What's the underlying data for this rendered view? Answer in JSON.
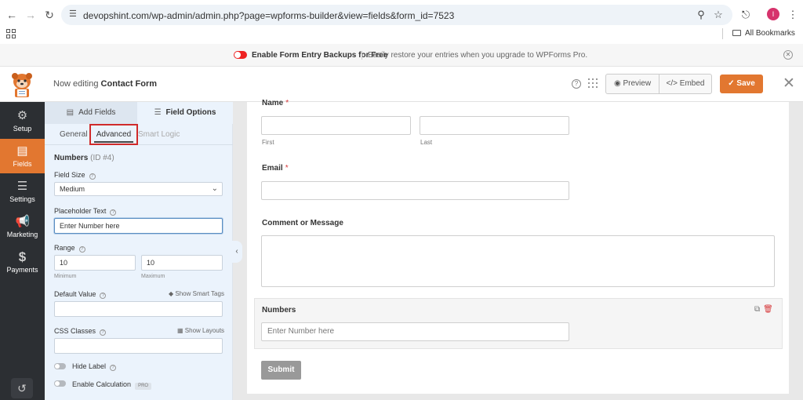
{
  "browser": {
    "url": "devopshint.com/wp-admin/admin.php?page=wpforms-builder&view=fields&form_id=7523",
    "bookmarks_label": "All Bookmarks",
    "profile_initial": "I"
  },
  "notice": {
    "title": "Enable Form Entry Backups for Free",
    "text": "Easily restore your entries when you upgrade to WPForms Pro."
  },
  "header": {
    "editing_prefix": "Now editing",
    "form_name": "Contact Form",
    "preview_label": "Preview",
    "embed_label": "Embed",
    "save_label": "Save"
  },
  "sidebar": {
    "items": [
      {
        "label": "Setup",
        "icon": "gear-icon"
      },
      {
        "label": "Fields",
        "icon": "fields-icon"
      },
      {
        "label": "Settings",
        "icon": "sliders-icon"
      },
      {
        "label": "Marketing",
        "icon": "megaphone-icon"
      },
      {
        "label": "Payments",
        "icon": "dollar-icon"
      }
    ]
  },
  "panel": {
    "tab_add_fields": "Add Fields",
    "tab_field_options": "Field Options",
    "subtab_general": "General",
    "subtab_advanced": "Advanced",
    "subtab_smart_logic": "Smart Logic",
    "field_name": "Numbers",
    "field_id": "(ID #4)",
    "field_size_label": "Field Size",
    "field_size_value": "Medium",
    "placeholder_label": "Placeholder Text",
    "placeholder_value": "Enter Number here",
    "range_label": "Range",
    "range_min": "10",
    "range_max": "10",
    "range_min_label": "Minimum",
    "range_max_label": "Maximum",
    "default_value_label": "Default Value",
    "show_smart_tags": "Show Smart Tags",
    "css_classes_label": "CSS Classes",
    "show_layouts": "Show Layouts",
    "hide_label": "Hide Label",
    "enable_calculation": "Enable Calculation",
    "pro_badge": "PRO"
  },
  "form": {
    "name_label": "Name",
    "first_label": "First",
    "last_label": "Last",
    "email_label": "Email",
    "comment_label": "Comment or Message",
    "numbers_label": "Numbers",
    "numbers_placeholder": "Enter Number here",
    "required_mark": "*",
    "submit_label": "Submit"
  },
  "colors": {
    "accent": "#e27730",
    "sidebar_bg": "#2c2f33",
    "panel_bg": "#ebf3fc",
    "highlight_box": "#d02a2a",
    "required": "#d63638"
  }
}
